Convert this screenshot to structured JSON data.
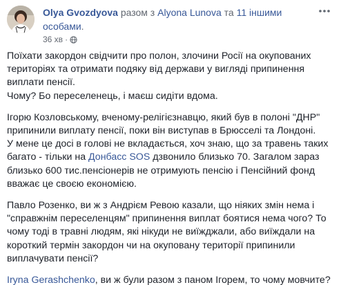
{
  "header": {
    "author": "Olya Gvozdyova",
    "with_word": " разом з ",
    "tagged_person": "Alyona Lunova",
    "and_word": " та ",
    "others_line1": "11 іншими",
    "others_line2": "особами",
    "others_dot": "."
  },
  "meta": {
    "time": "36 хв",
    "separator": "·"
  },
  "paragraphs": {
    "p1": {
      "l1": "Поїхати закордон свідчити про полон, злочини Росії на окупованих",
      "l2": "територіях та отримати подяку від держави у вигляді припинення",
      "l3": "виплати пенсії.",
      "l4": "Чому? Бо переселенець, і маєш сидіти вдома."
    },
    "p2": {
      "l1": "Ігорю Козловському, вченому-релігієзнавцю, який був в полоні \"ДНР\"",
      "l2": "припинили виплату пенсії, поки він виступав в Брюсселі та Лондоні.",
      "l3": "У мене це досі в голові не вкладається, хоч знаю, що за травень таких",
      "l4a": "багато - тільки на ",
      "l4_link": "Донбасс SOS",
      "l4b": " дзвонило близько 70. Загалом зараз",
      "l5": "близько 600 тис.пенсіонерів не отримують пенсію і Пенсійний фонд",
      "l6": "вважає це своєю економією."
    },
    "p3": {
      "l1": "Павло Розенко, ви ж з Андрієм Ревою казали, що ніяких змін нема і",
      "l2": "\"справжнім переселенцям\" припинення виплат боятися нема чого? То",
      "l3": "чому тоді в травні людям, які нікуди не виїжджали, або виїждали на",
      "l4": "короткий термін закордон чи на окуповану території припинили",
      "l5": "виплачувати пенсії?"
    },
    "p4": {
      "mention": "Iryna Gerashchenko",
      "rest": ", ви ж були разом з паном Ігорем, то чому мовчите?"
    }
  },
  "colors": {
    "link": "#385898",
    "text": "#1d2129",
    "meta": "#616770"
  },
  "icons": {
    "privacy": "globe-icon",
    "more": "more-options-icon",
    "avatar": "avatar"
  }
}
